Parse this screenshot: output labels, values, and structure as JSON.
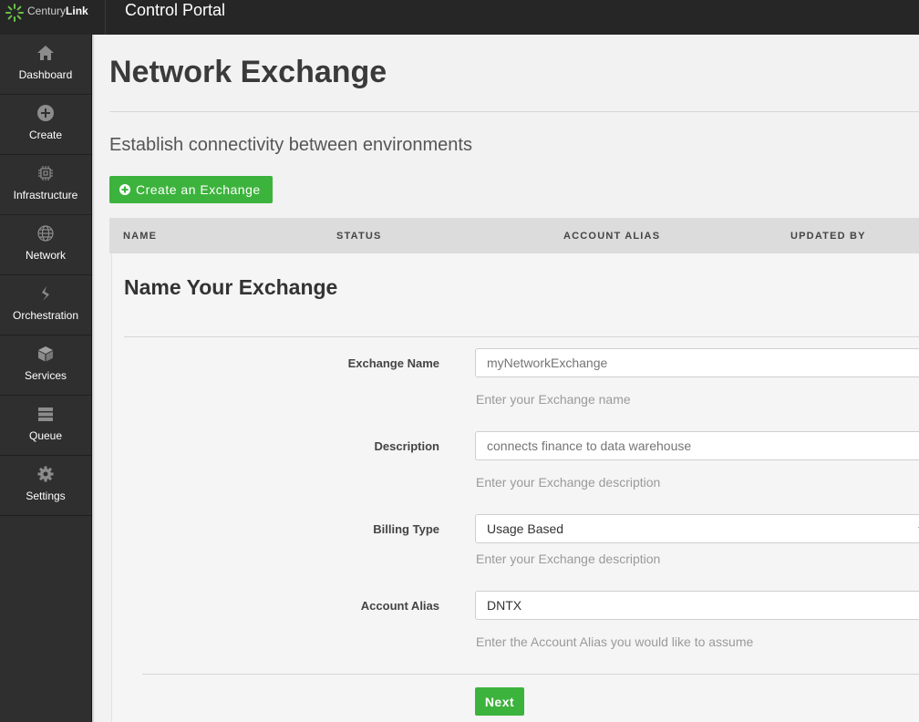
{
  "header": {
    "brand_prefix": "Century",
    "brand_suffix": "Link",
    "app_title": "Control Portal"
  },
  "sidebar": {
    "items": [
      {
        "label": "Dashboard",
        "icon": "home-icon"
      },
      {
        "label": "Create",
        "icon": "plus-circle-icon"
      },
      {
        "label": "Infrastructure",
        "icon": "chip-icon"
      },
      {
        "label": "Network",
        "icon": "globe-icon"
      },
      {
        "label": "Orchestration",
        "icon": "orchestration-icon"
      },
      {
        "label": "Services",
        "icon": "cube-icon"
      },
      {
        "label": "Queue",
        "icon": "queue-icon"
      },
      {
        "label": "Settings",
        "icon": "gear-icon"
      }
    ]
  },
  "page": {
    "title": "Network Exchange",
    "subtitle": "Establish connectivity between environments",
    "create_button": "Create an Exchange"
  },
  "table": {
    "columns": [
      "NAME",
      "STATUS",
      "ACCOUNT ALIAS",
      "UPDATED BY"
    ]
  },
  "form": {
    "title": "Name Your Exchange",
    "fields": [
      {
        "label": "Exchange Name",
        "value": "",
        "placeholder": "myNetworkExchange",
        "helper": "Enter your Exchange name"
      },
      {
        "label": "Description",
        "value": "",
        "placeholder": "connects finance to data warehouse",
        "helper": "Enter your Exchange description"
      },
      {
        "label": "Billing Type",
        "value": "Usage Based",
        "helper": "Enter your Exchange description"
      },
      {
        "label": "Account Alias",
        "value": "DNTX",
        "helper": "Enter the Account Alias you would like to assume"
      }
    ],
    "next_button": "Next"
  },
  "colors": {
    "accent_green": "#3cb33c",
    "topbar": "#262626",
    "sidebar": "#2f2f2f"
  }
}
